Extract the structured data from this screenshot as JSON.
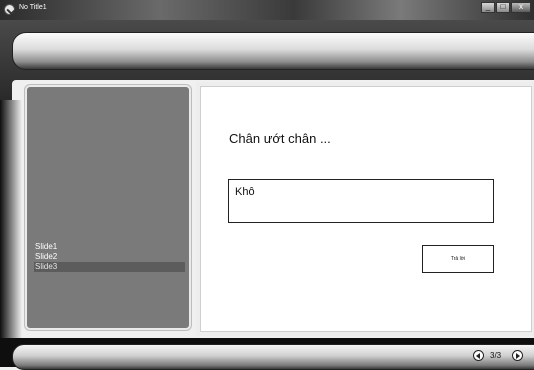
{
  "window": {
    "title": "No Title1",
    "controls": {
      "minimize": "_",
      "maximize": "□",
      "close": "x"
    }
  },
  "slides": {
    "items": [
      "Slide1",
      "Slide2",
      "Slide3"
    ],
    "selected_index": 2
  },
  "slide": {
    "question": "Chân ướt chân ...",
    "answer": "Khô",
    "submit_label": "Trả lời"
  },
  "navigation": {
    "counter": "3/3",
    "prev_icon": "chevron-left-icon",
    "next_icon": "chevron-right-icon"
  },
  "colors": {
    "frame": "#121212",
    "slide_panel": "#7a7a7a",
    "selected_slide": "#5c5c5c",
    "canvas": "#ffffff"
  }
}
